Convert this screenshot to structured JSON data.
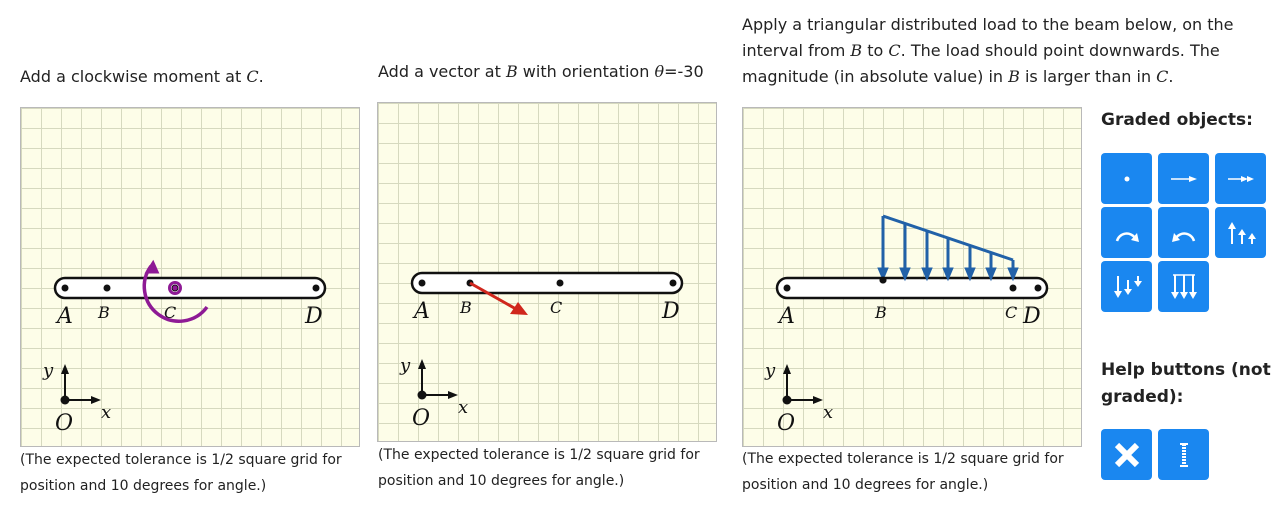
{
  "panel1": {
    "prompt_before": "Add a clockwise moment at ",
    "prompt_point": "C",
    "prompt_after": ".",
    "labels": {
      "A": "A",
      "B": "B",
      "C": "C",
      "D": "D",
      "x": "x",
      "y": "y",
      "O": "O"
    },
    "tolerance_line1": "(The expected tolerance is 1/2 square grid for",
    "tolerance_line2": "position and 10 degrees for angle.)"
  },
  "panel2": {
    "prompt_before": "Add a vector at ",
    "prompt_point": "B",
    "prompt_middle": " with orientation ",
    "prompt_theta": "θ",
    "prompt_value": "=-30",
    "labels": {
      "A": "A",
      "B": "B",
      "C": "C",
      "D": "D",
      "x": "x",
      "y": "y",
      "O": "O"
    },
    "tolerance_line1": "(The expected tolerance is 1/2 square grid for",
    "tolerance_line2": "position and 10 degrees for angle.)"
  },
  "panel3": {
    "prompt_line1": "Apply a triangular distributed load to the beam below, on the",
    "prompt_l2_a": "interval from ",
    "prompt_l2_b": "B",
    "prompt_l2_c": " to ",
    "prompt_l2_d": "C",
    "prompt_l2_e": ". The load should point downwards. The",
    "prompt_l3_a": "magnitude (in absolute value) in ",
    "prompt_l3_b": "B",
    "prompt_l3_c": " is larger than in ",
    "prompt_l3_d": "C",
    "prompt_l3_e": ".",
    "labels": {
      "A": "A",
      "B": "B",
      "C": "C",
      "D": "D",
      "x": "x",
      "y": "y",
      "O": "O"
    },
    "tolerance_line1": "(The expected tolerance is 1/2 square grid for",
    "tolerance_line2": "position and 10 degrees for angle.)"
  },
  "sidebar": {
    "graded_title": "Graded objects:",
    "help_title_line1": "Help buttons (not",
    "help_title_line2": "graded):",
    "graded_buttons": [
      "point-icon",
      "vector-icon",
      "double-headed-vector-icon",
      "clockwise-moment-icon",
      "counterclockwise-moment-icon",
      "distributed-load-up-icon",
      "triangular-load-down-icon",
      "uniform-load-down-icon"
    ],
    "help_buttons": [
      "delete-icon",
      "help-line-icon"
    ]
  },
  "colors": {
    "moment": "#8e1a95",
    "vector": "#d0271d",
    "load": "#2161a8",
    "button": "#1a87f0",
    "grid_bg": "#fdfde8",
    "grid_line": "#d6d9bf"
  }
}
